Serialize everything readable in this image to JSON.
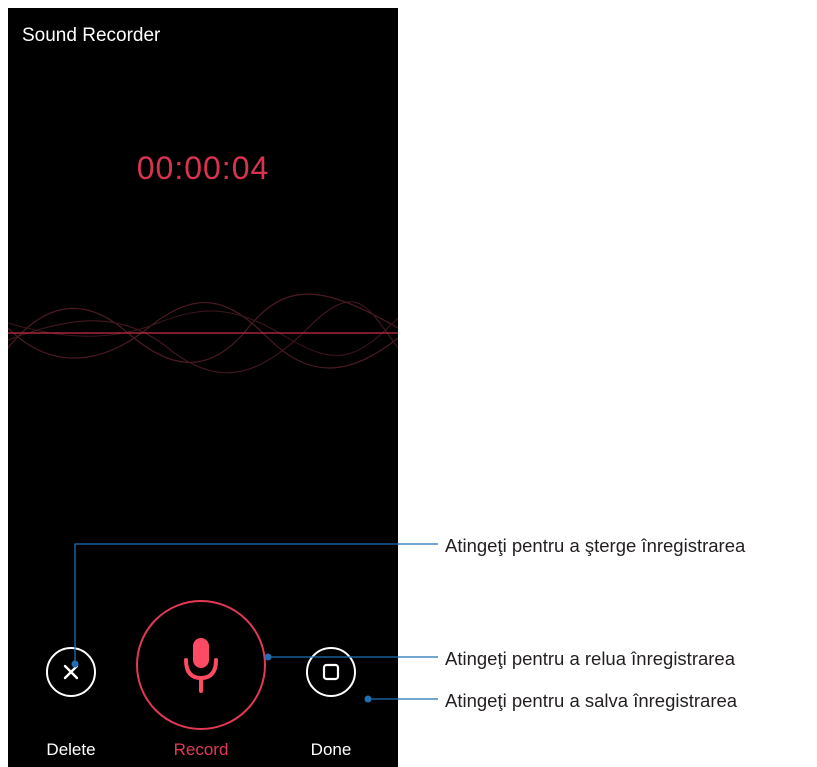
{
  "app": {
    "title": "Sound Recorder"
  },
  "recording": {
    "elapsed": "00:00:04"
  },
  "controls": {
    "delete_label": "Delete",
    "record_label": "Record",
    "done_label": "Done"
  },
  "callouts": {
    "delete": "Atingeţi pentru a şterge înregistrarea",
    "record": "Atingeţi pentru a relua înregistrarea",
    "done": "Atingeţi pentru a salva înregistrarea"
  },
  "colors": {
    "accent": "#e23a55",
    "background": "#000000",
    "callout_line": "#1f6fb2"
  },
  "icons": {
    "delete": "close-icon",
    "record": "microphone-icon",
    "done": "stop-icon"
  }
}
